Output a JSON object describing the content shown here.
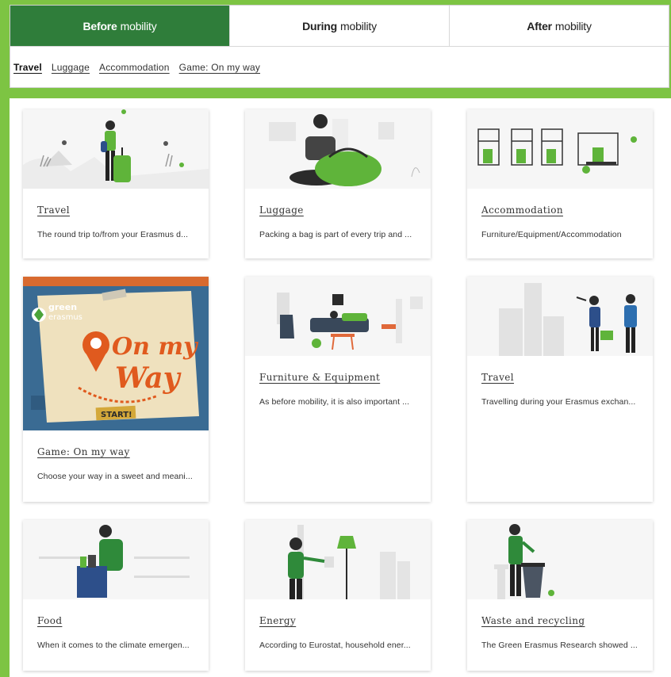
{
  "tabs": [
    {
      "bold": "Before",
      "rest": "mobility"
    },
    {
      "bold": "During",
      "rest": "mobility"
    },
    {
      "bold": "After",
      "rest": "mobility"
    }
  ],
  "subnav": [
    "Travel",
    "Luggage",
    "Accommodation",
    "Game: On my way"
  ],
  "cards": [
    {
      "title": "Travel",
      "desc": "The round trip to/from your Erasmus d..."
    },
    {
      "title": "Luggage",
      "desc": "Packing a bag is part of every trip and ..."
    },
    {
      "title": "Accommodation",
      "desc": "Furniture/Equipment/Accommodation"
    },
    {
      "title": "Game: On my way",
      "desc": "Choose your way in a sweet and meani..."
    },
    {
      "title": "Furniture & Equipment",
      "desc": "As before mobility, it is also important ..."
    },
    {
      "title": "Travel",
      "desc": "Travelling during your Erasmus exchan..."
    },
    {
      "title": "Food",
      "desc": "When it comes to the climate emergen..."
    },
    {
      "title": "Energy",
      "desc": "According to Eurostat, household ener..."
    },
    {
      "title": "Waste and recycling",
      "desc": "The Green Erasmus Research showed ..."
    }
  ],
  "game_art": {
    "logo_top": "green",
    "logo_bottom": "erasmus",
    "headline_1": "On my",
    "headline_2": "Way",
    "button": "START!"
  },
  "colors": {
    "page_green": "#7dc443",
    "tab_active": "#2f7d3a",
    "illus_green": "#5fb43a"
  }
}
